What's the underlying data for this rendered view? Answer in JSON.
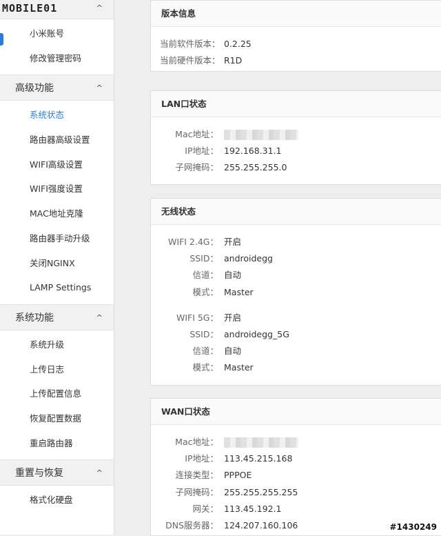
{
  "sidebar": {
    "logo": "MOBILE01",
    "groups": [
      {
        "title": "",
        "items": [
          "小米账号",
          "修改管理密码"
        ]
      },
      {
        "title": "高级功能",
        "items": [
          "系统状态",
          "路由器高级设置",
          "WIFI高级设置",
          "WIFI强度设置",
          "MAC地址克隆",
          "路由器手动升级",
          "关闭NGINX",
          "LAMP Settings"
        ]
      },
      {
        "title": "系统功能",
        "items": [
          "系统升级",
          "上传日志",
          "上传配置信息",
          "恢复配置数据",
          "重启路由器"
        ]
      },
      {
        "title": "重置与恢复",
        "items": [
          "格式化硬盘"
        ]
      }
    ],
    "chevron": "^"
  },
  "version": {
    "title": "版本信息",
    "software_label": "当前软件版本：",
    "software_value": "0.2.25",
    "hardware_label": "当前硬件版本：",
    "hardware_value": "R1D"
  },
  "lan": {
    "title": "LAN口状态",
    "mac_label": "Mac地址：",
    "ip_label": "IP地址：",
    "ip_value": "192.168.31.1",
    "mask_label": "子网掩码：",
    "mask_value": "255.255.255.0"
  },
  "wireless": {
    "title": "无线状态",
    "g24": {
      "label": "WIFI 2.4G：",
      "value": "开启",
      "ssid_label": "SSID：",
      "ssid": "androidegg",
      "channel_label": "信道：",
      "channel": "自动",
      "mode_label": "模式：",
      "mode": "Master"
    },
    "g5": {
      "label": "WIFI 5G：",
      "value": "开启",
      "ssid_label": "SSID：",
      "ssid": "androidegg_5G",
      "channel_label": "信道：",
      "channel": "自动",
      "mode_label": "模式：",
      "mode": "Master"
    }
  },
  "wan": {
    "title": "WAN口状态",
    "mac_label": "Mac地址：",
    "ip_label": "IP地址：",
    "ip_value": "113.45.215.168",
    "type_label": "连接类型：",
    "type_value": "PPPOE",
    "mask_label": "子网掩码：",
    "mask_value": "255.255.255.255",
    "gateway_label": "网关：",
    "gateway_value": "113.45.192.1",
    "dns_label": "DNS服务器：",
    "dns_value": "124.207.160.106"
  },
  "watermark": "#1430249",
  "colors": {
    "accent": "#2a7dd3",
    "active_text": "#2a7dd3"
  }
}
